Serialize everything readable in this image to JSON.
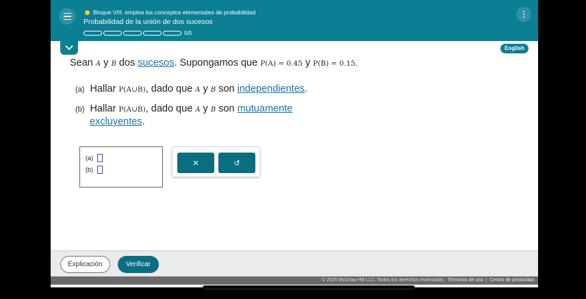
{
  "header": {
    "topic": "Bloque VIII: emplea los conceptos elementales de probabilidad",
    "subtitle": "Probabilidad de la unión de dos sucesos",
    "progress_text": "0/5",
    "progress_segments": 5,
    "progress_done": 0,
    "accent": "#0b7f94",
    "dot_color": "#e9d23a"
  },
  "language_button": "English",
  "problem": {
    "intro_1": "Sean ",
    "A": "A",
    "y": " y ",
    "B": "B",
    "intro_2": " dos ",
    "sucesos_link": "sucesos",
    "intro_3": ". Supongamos que ",
    "pa_expr": "P(A) = 0.45",
    "y2": " y ",
    "pb_expr": "P(B) = 0.15.",
    "qa_label": "(a)",
    "qa_text_1": "Hallar ",
    "qa_expr": "P(A∪B)",
    "qa_text_2": ", dado que ",
    "qa_text_3": " son ",
    "qa_link": "independientes",
    "qa_end": ".",
    "qb_label": "(b)",
    "qb_link_1": "mutuamente",
    "qb_link_2": "excluyentes",
    "qb_end": "."
  },
  "answers": {
    "a_label": "(a)",
    "b_label": "(b)"
  },
  "buttons": {
    "clear": "×",
    "undo": "↺",
    "explain": "Explicación",
    "verify": "Verificar"
  },
  "legal": {
    "copyright": "© 2025 McGraw Hill LLC. Todos los derechos reservados.",
    "terms": "Términos de uso",
    "sep": "|",
    "privacy": "Centro de privacidad"
  }
}
